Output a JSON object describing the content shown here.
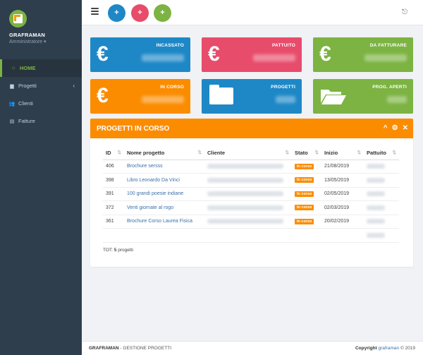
{
  "brand": {
    "name": "GRAFRAMAN",
    "role": "Amministratore ▾"
  },
  "nav": [
    {
      "label": "HOME",
      "icon": "home-icon",
      "glyph": "⌂"
    },
    {
      "label": "Progetti",
      "icon": "folder-icon",
      "glyph": "▆"
    },
    {
      "label": "Clienti",
      "icon": "users-icon",
      "glyph": "👥"
    },
    {
      "label": "Fatture",
      "icon": "file-icon",
      "glyph": "▤"
    }
  ],
  "topbar": {
    "buttons": [
      {
        "icon": "add-folder-icon",
        "glyph": "+",
        "color": "#1e88c7"
      },
      {
        "icon": "add-user-icon",
        "glyph": "+",
        "color": "#e84c6b"
      },
      {
        "icon": "add-file-icon",
        "glyph": "+",
        "color": "#7cb342"
      }
    ],
    "logout_glyph": "⎋"
  },
  "cards": [
    {
      "title": "INCASSATO",
      "color": "#1e88c7",
      "icon": "euro-icon"
    },
    {
      "title": "PATTUITO",
      "color": "#e84c6b",
      "icon": "euro-icon"
    },
    {
      "title": "DA FATTURARE",
      "color": "#7cb342",
      "icon": "euro-icon"
    },
    {
      "title": "IN CORSO",
      "color": "#fb8c00",
      "icon": "euro-icon"
    },
    {
      "title": "PROGETTI",
      "color": "#1e88c7",
      "icon": "folder-icon"
    },
    {
      "title": "PROG. APERTI",
      "color": "#7cb342",
      "icon": "folder-open-icon"
    }
  ],
  "euro_glyph": "€",
  "panel": {
    "title": "PROGETTI IN CORSO",
    "tools": [
      "^",
      "⚙",
      "✕"
    ],
    "columns": [
      "ID",
      "Nome progetto",
      "Cliente",
      "Stato",
      "Inizio",
      "Pattuito"
    ],
    "rows": [
      {
        "id": "406",
        "name": "Brochure sersss",
        "stato": "In corso",
        "inizio": "21/08/2019"
      },
      {
        "id": "398",
        "name": "Libro Leonardo Da Vinci",
        "stato": "In corso",
        "inizio": "13/05/2019"
      },
      {
        "id": "391",
        "name": "100 grandi poesie indiane",
        "stato": "In corso",
        "inizio": "02/05/2019"
      },
      {
        "id": "372",
        "name": "Venti giornate al rogo",
        "stato": "In corso",
        "inizio": "02/03/2019"
      },
      {
        "id": "361",
        "name": "Brochure Corso Laurea Fisica",
        "stato": "In corso",
        "inizio": "20/02/2019"
      }
    ],
    "total_prefix": "TOT: ",
    "total_count": "5",
    "total_suffix": " progetti"
  },
  "footer": {
    "brand": "GRAFRAMAN",
    "subtitle": " - GESTIONE PROGETTI",
    "copyright_label": "Copyright",
    "copyright_owner": "graframan",
    "copyright_year": "© 2019"
  }
}
